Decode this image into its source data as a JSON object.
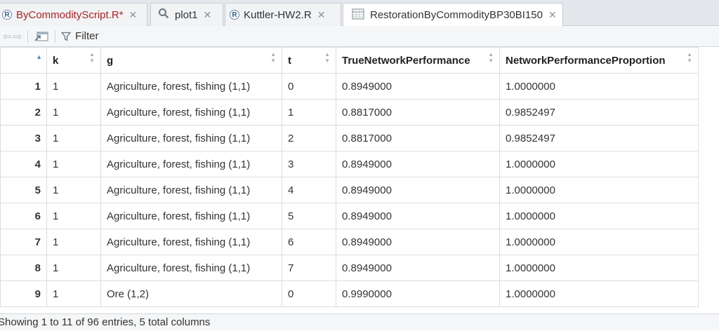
{
  "tabs": [
    {
      "label": "ByCommodityScript.R*",
      "icon": "r-file-icon",
      "color": "#b22222"
    },
    {
      "label": "plot1",
      "icon": "magnifier-icon"
    },
    {
      "label": "Kuttler-HW2.R",
      "icon": "r-file-icon"
    },
    {
      "label": "RestorationByCommodityBP30BI150",
      "icon": "grid-icon",
      "active": true
    }
  ],
  "toolbar": {
    "filter_label": "Filter"
  },
  "table": {
    "columns": [
      "k",
      "g",
      "t",
      "TrueNetworkPerformance",
      "NetworkPerformanceProportion"
    ],
    "rows": [
      {
        "n": "1",
        "k": "1",
        "g": "Agriculture, forest, fishing (1,1)",
        "t": "0",
        "tnp": "0.8949000",
        "npp": "1.0000000"
      },
      {
        "n": "2",
        "k": "1",
        "g": "Agriculture, forest, fishing (1,1)",
        "t": "1",
        "tnp": "0.8817000",
        "npp": "0.9852497"
      },
      {
        "n": "3",
        "k": "1",
        "g": "Agriculture, forest, fishing (1,1)",
        "t": "2",
        "tnp": "0.8817000",
        "npp": "0.9852497"
      },
      {
        "n": "4",
        "k": "1",
        "g": "Agriculture, forest, fishing (1,1)",
        "t": "3",
        "tnp": "0.8949000",
        "npp": "1.0000000"
      },
      {
        "n": "5",
        "k": "1",
        "g": "Agriculture, forest, fishing (1,1)",
        "t": "4",
        "tnp": "0.8949000",
        "npp": "1.0000000"
      },
      {
        "n": "6",
        "k": "1",
        "g": "Agriculture, forest, fishing (1,1)",
        "t": "5",
        "tnp": "0.8949000",
        "npp": "1.0000000"
      },
      {
        "n": "7",
        "k": "1",
        "g": "Agriculture, forest, fishing (1,1)",
        "t": "6",
        "tnp": "0.8949000",
        "npp": "1.0000000"
      },
      {
        "n": "8",
        "k": "1",
        "g": "Agriculture, forest, fishing (1,1)",
        "t": "7",
        "tnp": "0.8949000",
        "npp": "1.0000000"
      },
      {
        "n": "9",
        "k": "1",
        "g": "Ore (1,2)",
        "t": "0",
        "tnp": "0.9990000",
        "npp": "1.0000000"
      }
    ]
  },
  "status": {
    "text": "Showing 1 to 11 of 96 entries, 5 total columns"
  }
}
